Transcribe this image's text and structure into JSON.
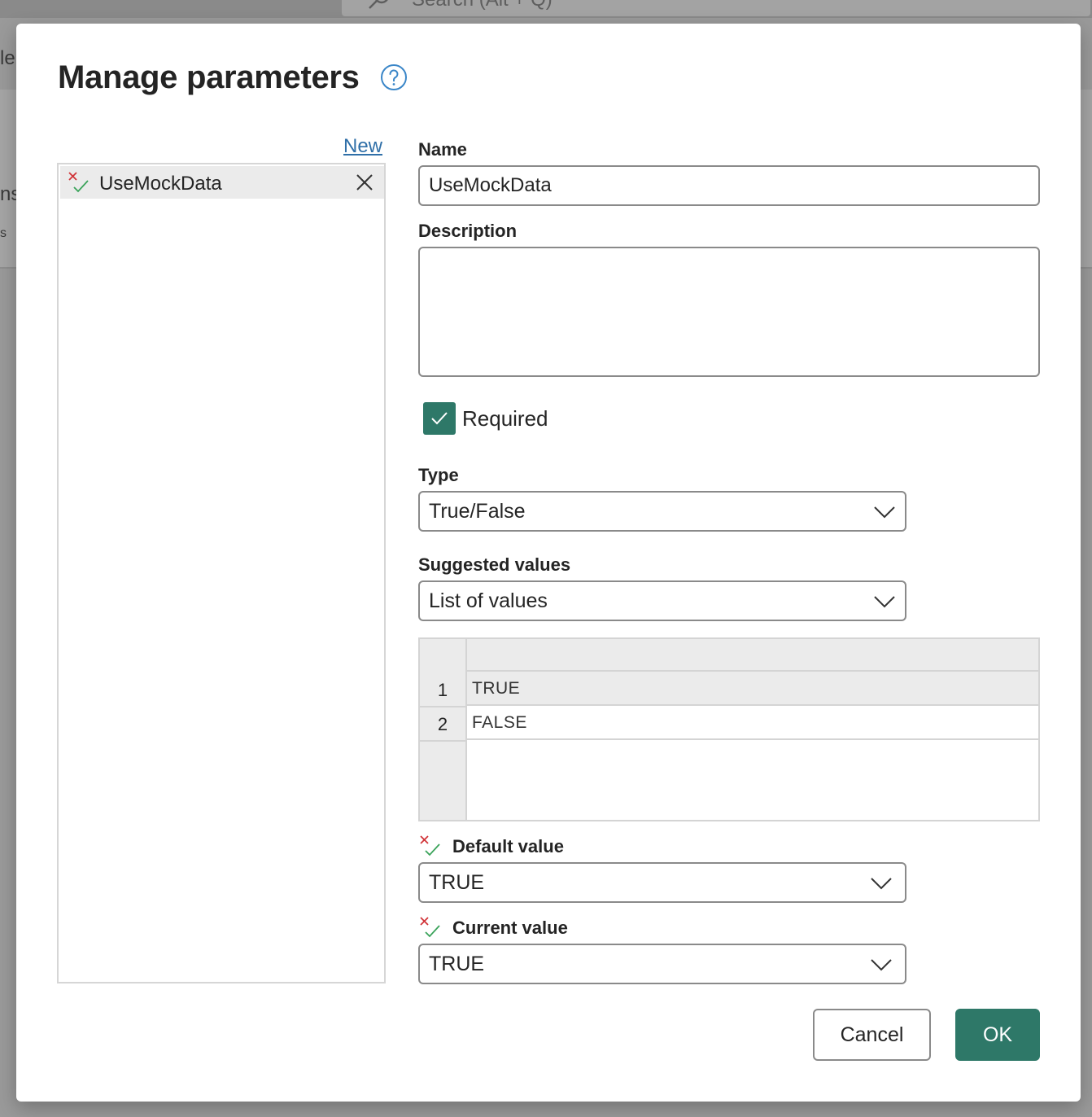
{
  "background": {
    "search_text": "Search (Alt + Q)",
    "left_fragments": [
      "le",
      "ns",
      "s"
    ]
  },
  "dialog": {
    "title": "Manage parameters",
    "help_icon": "help-circle-icon"
  },
  "param_list": {
    "new_link": "New",
    "items": [
      {
        "label": "UseMockData",
        "selected": true,
        "icon": "type-any-icon"
      }
    ]
  },
  "form": {
    "name_label": "Name",
    "name_value": "UseMockData",
    "description_label": "Description",
    "description_value": "",
    "required_label": "Required",
    "required_checked": true,
    "type_label": "Type",
    "type_value": "True/False",
    "suggested_label": "Suggested values",
    "suggested_value": "List of values",
    "values_grid": [
      {
        "row": "1",
        "value": "TRUE",
        "selected": true
      },
      {
        "row": "2",
        "value": "FALSE",
        "selected": false
      }
    ],
    "default_label": "Default value",
    "default_value": "TRUE",
    "current_label": "Current value",
    "current_value": "TRUE"
  },
  "buttons": {
    "cancel": "Cancel",
    "ok": "OK"
  },
  "colors": {
    "accent": "#2e7868",
    "link": "#2f6fa8",
    "help": "#3a86c8",
    "error_x": "#d13438",
    "check_green": "#3aa35a"
  }
}
